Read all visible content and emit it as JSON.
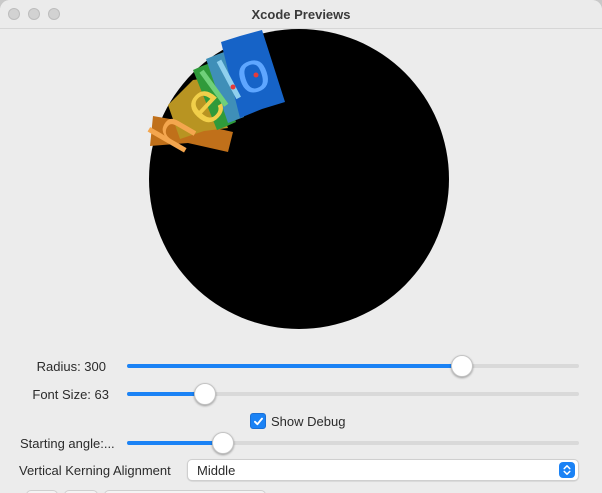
{
  "window": {
    "title": "Xcode Previews"
  },
  "preview": {
    "arc_text": "hello",
    "letter_band_colors": [
      "#c0701a",
      "#b89422",
      "#2f9a3a",
      "#3f8fb8",
      "#1663c7"
    ],
    "circle_color": "#000000"
  },
  "controls": {
    "radius": {
      "label": "Radius: 300",
      "value_fraction": 0.74
    },
    "font_size": {
      "label": "Font Size: 63",
      "value_fraction": 0.17
    },
    "show_debug": {
      "label": "Show Debug",
      "checked": true
    },
    "starting_angle": {
      "label": "Starting angle:...",
      "value_fraction": 0.21
    },
    "vertical_kerning": {
      "label": "Vertical Kerning Alignment",
      "selected": "Middle"
    }
  },
  "colors": {
    "accent": "#1a82f5"
  }
}
